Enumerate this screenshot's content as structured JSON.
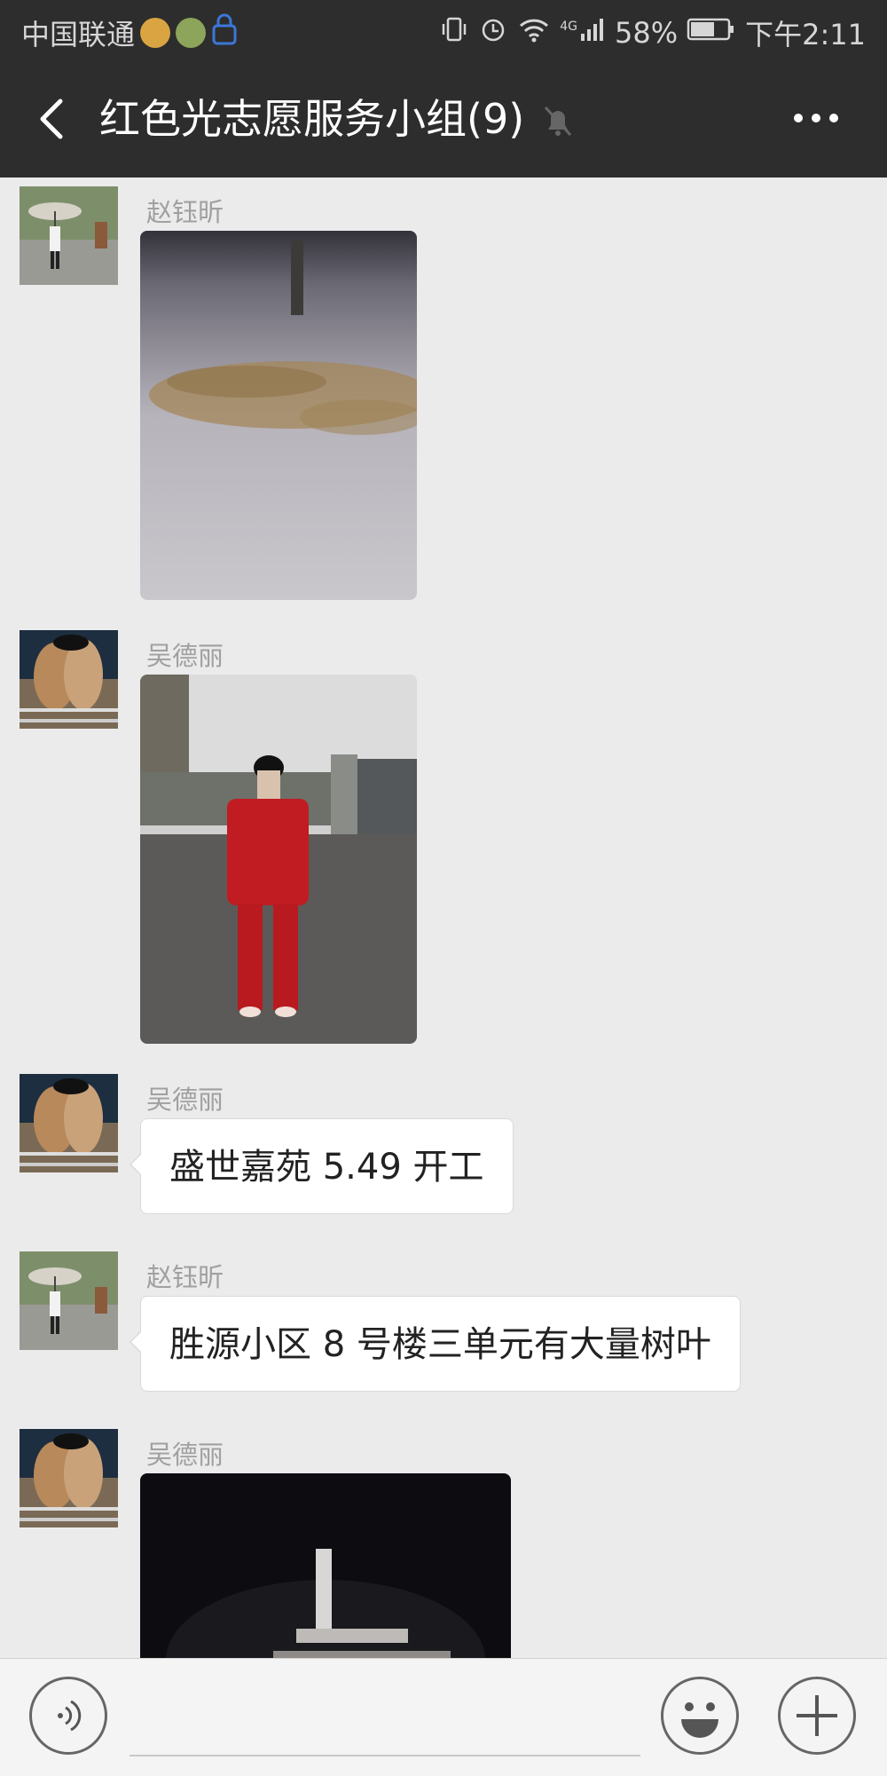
{
  "status_bar": {
    "carrier": "中国联通",
    "battery": "58%",
    "network": "4G",
    "time": "下午2:11"
  },
  "header": {
    "title": "红色光志愿服务小组(9)",
    "icons": [
      "back-arrow-icon",
      "mute-bell-icon",
      "more-icon"
    ]
  },
  "messages": [
    {
      "sender": "赵钰昕",
      "type": "image",
      "image": "scattered leaves on pavement at night"
    },
    {
      "sender": "吴德丽",
      "type": "image",
      "image": "girl in red tracksuit standing outdoors"
    },
    {
      "sender": "吴德丽",
      "type": "text",
      "text": "盛世嘉苑 5.49 开工"
    },
    {
      "sender": "赵钰昕",
      "type": "text",
      "text": "胜源小区 8 号楼三单元有大量树叶"
    },
    {
      "sender": "吴德丽",
      "type": "image",
      "image": "dark photo of post at night"
    }
  ],
  "input_bar": {
    "icons": [
      "voice-icon",
      "emoji-icon",
      "plus-icon"
    ]
  }
}
